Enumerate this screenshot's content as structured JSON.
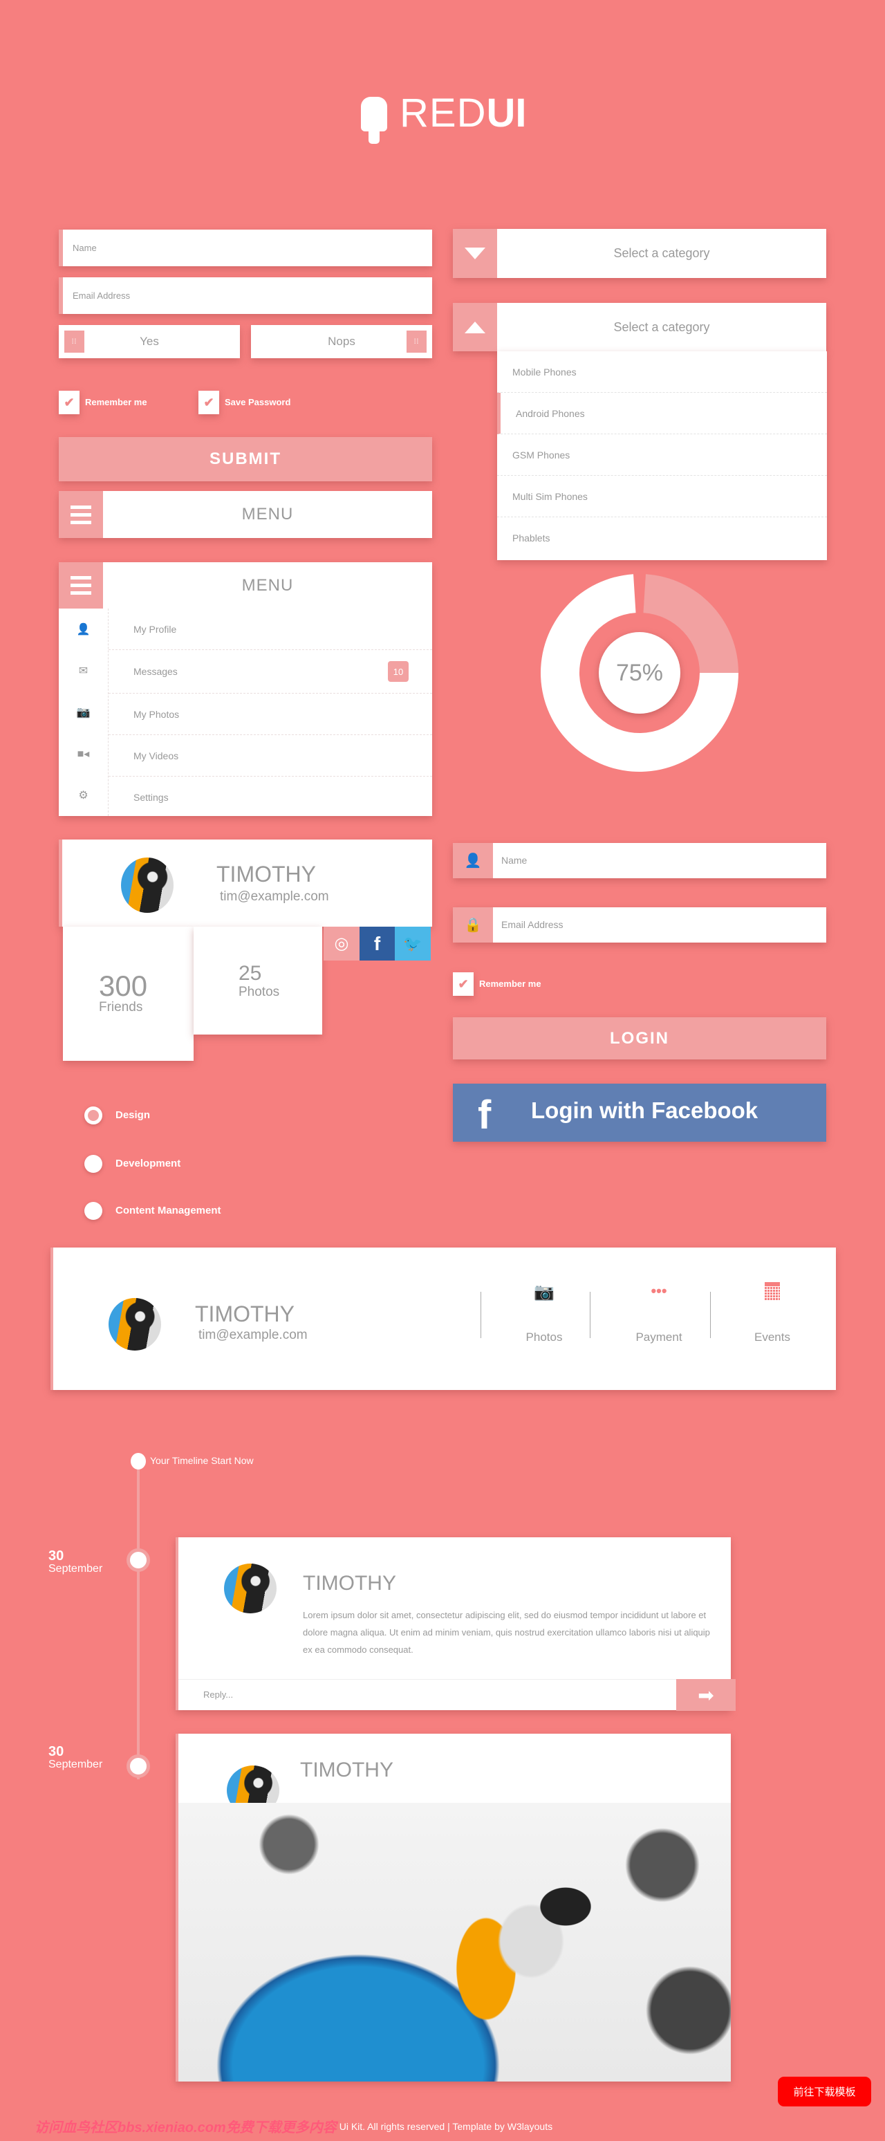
{
  "logo": {
    "text_light": "RED",
    "text_bold": "UI",
    "icon": "popsicle-icon"
  },
  "form": {
    "name_placeholder": "Name",
    "email_placeholder": "Email Address",
    "yes_label": "Yes",
    "no_label": "Nops",
    "remember_label": "Remember me",
    "save_label": "Save Password",
    "submit_label": "SUBMIT",
    "remember_checked": true,
    "save_checked": true
  },
  "selects": {
    "placeholder": "Select a category",
    "options": [
      "Mobile Phones",
      "Android Phones",
      "GSM Phones",
      "Multi Sim Phones",
      "Phablets"
    ]
  },
  "menu": {
    "title": "MENU",
    "items": [
      {
        "label": "My Profile",
        "icon": "user-icon"
      },
      {
        "label": "Messages",
        "icon": "envelope-icon",
        "badge": "10"
      },
      {
        "label": "My Photos",
        "icon": "camera-icon"
      },
      {
        "label": "My Videos",
        "icon": "video-icon"
      },
      {
        "label": "Settings",
        "icon": "gear-icon"
      }
    ]
  },
  "donut": {
    "label": "75%",
    "value_percent": 75,
    "colors": {
      "main": "#ffffff",
      "rest": "#f2a1a1"
    }
  },
  "profile": {
    "name": "TIMOTHY",
    "email": "tim@example.com",
    "friends_count": "300",
    "friends_label": "Friends",
    "photos_count": "25",
    "photos_label": "Photos",
    "social": [
      "dribbble-icon",
      "facebook-icon",
      "twitter-icon"
    ]
  },
  "radios": {
    "items": [
      "Design",
      "Development",
      "Content Management"
    ],
    "selected": 0
  },
  "login": {
    "name_placeholder": "Name",
    "email_placeholder": "Email Address",
    "remember_label": "Remember me",
    "login_label": "LOGIN",
    "facebook_label": "Login with Facebook"
  },
  "profile_bar": {
    "name": "TIMOTHY",
    "email": "tim@example.com",
    "actions": [
      {
        "label": "Photos",
        "icon": "camera-icon"
      },
      {
        "label": "Payment",
        "icon": "dots-icon"
      },
      {
        "label": "Events",
        "icon": "calendar-icon"
      }
    ]
  },
  "timeline": {
    "start_label": "Your Timeline Start Now",
    "posts": [
      {
        "day": "30",
        "month": "September",
        "name": "TIMOTHY",
        "text": "Lorem ipsum dolor sit amet, consectetur adipiscing elit, sed do eiusmod tempor incididunt ut labore et dolore magna aliqua. Ut enim ad minim veniam, quis nostrud exercitation ullamco laboris nisi ut aliquip ex ea commodo consequat.",
        "reply_placeholder": "Reply..."
      },
      {
        "day": "30",
        "month": "September",
        "name": "TIMOTHY"
      }
    ]
  },
  "footer": {
    "watermark": "访问血鸟社区bbs.xieniao.com免费下载更多内容",
    "text": "Ui Kit. All rights reserved | Template by W3layouts",
    "download_button": "前往下载模板"
  },
  "colors": {
    "background": "#f67f7f",
    "accent_light": "#f2a1a1",
    "facebook": "#607fb3",
    "twitter": "#4bb8e8"
  }
}
